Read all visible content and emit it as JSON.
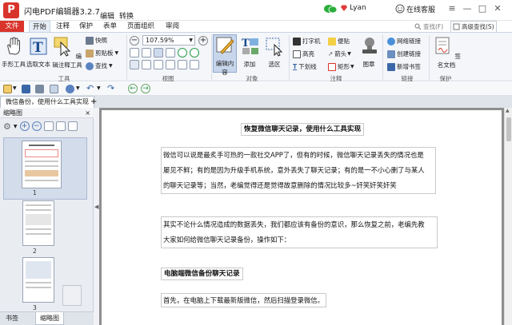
{
  "titlebar": {
    "app_title": "闪电PDF编辑器3.2.7",
    "menu_edit": "编辑",
    "menu_convert": "转换",
    "user_name": "Lyan",
    "online_service": "在线客服"
  },
  "ribbon_tabs": [
    "文件",
    "开始",
    "注释",
    "保护",
    "表单",
    "页面组织",
    "审阅"
  ],
  "ribbon_right": {
    "search_placeholder": "查找(F)",
    "advanced_search": "高级查找(S)"
  },
  "ribbon": {
    "tools_group": {
      "label": "工具",
      "hand_tool": "手形工具",
      "select_text": "选取文本",
      "edit_annot": "编辑注释工具",
      "snapshot": "快照",
      "clipboard": "剪贴板",
      "find": "查找"
    },
    "view_group": {
      "label": "视图",
      "zoom_value": "107.59%"
    },
    "object_group": {
      "label": "对象",
      "edit_content": "编辑内容",
      "add": "添加",
      "select_area": "选区"
    },
    "annot_group": {
      "label": "注释",
      "typewriter": "打字机",
      "note": "便贴",
      "highlight": "高亮",
      "arrow": "箭头",
      "underline": "下划线",
      "rectangle": "矩形",
      "stamp": "图章"
    },
    "link_group": {
      "label": "链接",
      "web_link": "网络链接",
      "create_link": "创建链接",
      "add_bookmark": "新增书签"
    },
    "protect_group": {
      "label": "保护",
      "sign_doc": "签名文档"
    }
  },
  "document_tab": "微信备份，使用什么工具实现",
  "sidebar": {
    "title": "缩略图",
    "close": "×",
    "pages": [
      "1",
      "2",
      "3"
    ],
    "bottom_tabs": [
      "书签",
      "缩略图"
    ]
  },
  "document": {
    "title": "恢复微信聊天记录，使用什么工具实现",
    "para1": [
      "微信可以说是最炙手可热的一款社交APP了，但有的时候，微信聊天记录丢失的情况也是",
      "屡见不鲜；有的是因为升级手机系统，意外丢失了聊天记录；有的是一不小心删了与某人",
      "的聊天记录等；当然，老编觉得还是觉得故意删除的情况比较多~奸笑奸笑奸笑"
    ],
    "para2": [
      "其实不论什么情况造成的数据丢失，我们都应该有备份的意识，那么恢复之前，老编先教",
      "大家如何给微信聊天记录备份，操作如下："
    ],
    "heading2": "电脑端微信备份聊天记录",
    "para3": "首先，在电脑上下载最新版微信，然后扫描登录微信。"
  },
  "colors": {
    "brand_red": "#d9342b",
    "accent_blue": "#3a67a8"
  }
}
